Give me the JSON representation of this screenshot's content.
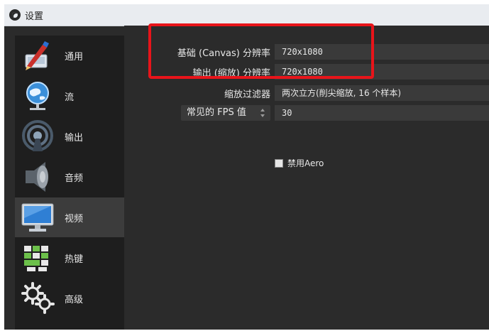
{
  "window": {
    "title": "设置"
  },
  "sidebar": {
    "items": [
      {
        "label": "通用",
        "icon": "general-settings-icon"
      },
      {
        "label": "流",
        "icon": "stream-globe-icon"
      },
      {
        "label": "输出",
        "icon": "output-broadcast-icon"
      },
      {
        "label": "音频",
        "icon": "audio-speaker-icon"
      },
      {
        "label": "视频",
        "icon": "video-monitor-icon",
        "active": true
      },
      {
        "label": "热键",
        "icon": "hotkeys-keyboard-icon"
      },
      {
        "label": "高级",
        "icon": "advanced-gears-icon"
      }
    ]
  },
  "video": {
    "base_resolution": {
      "label": "基础 (Canvas) 分辨率",
      "value": "720x1080"
    },
    "output_resolution": {
      "label": "输出 (缩放) 分辨率",
      "value": "720x1080"
    },
    "downscale_filter": {
      "label": "缩放过滤器",
      "value": "两次立方(削尖缩放, 16 个样本)"
    },
    "fps": {
      "label": "常见的 FPS 值",
      "value": "30"
    },
    "disable_aero": {
      "label": "禁用Aero",
      "checked": false
    }
  },
  "colors": {
    "background": "#2b2b2b",
    "sidebar": "#1e1e1e",
    "active_item": "#3c3c3c",
    "highlight": "#e8141a"
  }
}
